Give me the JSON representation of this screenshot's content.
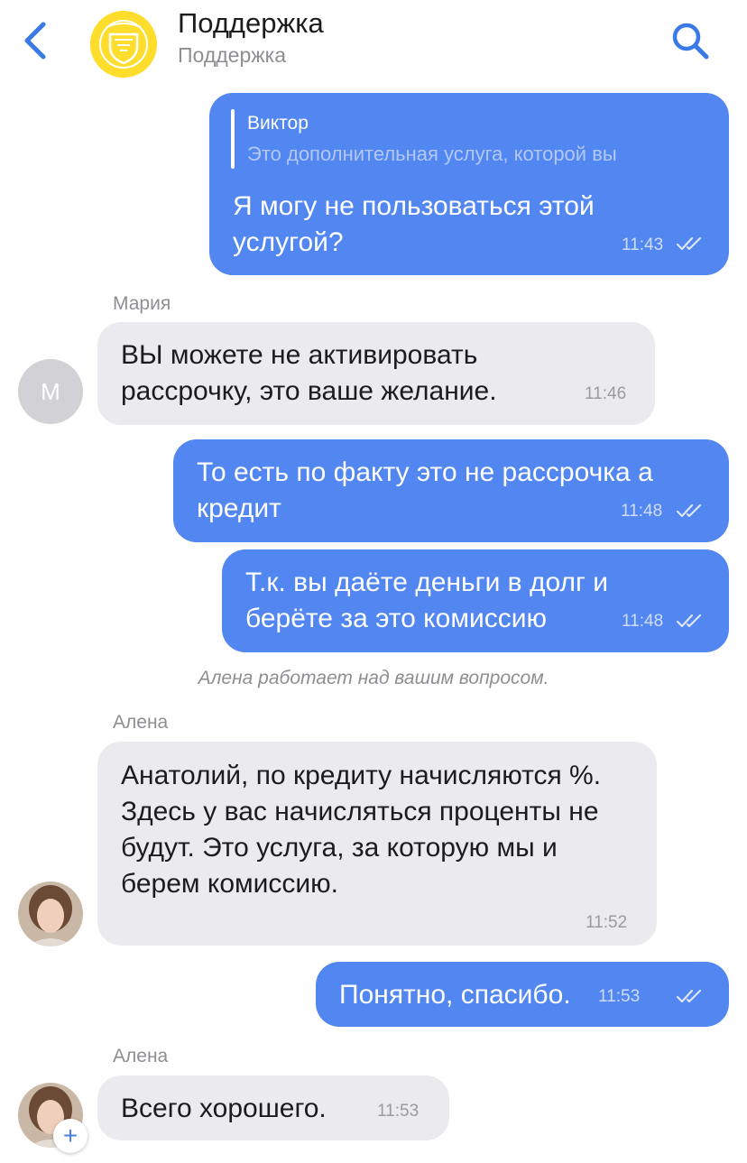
{
  "header": {
    "title": "Поддержка",
    "subtitle": "Поддержка"
  },
  "messages": [
    {
      "quote_author": "Виктор",
      "quote_text": "Это дополнительная услуга, которой вы",
      "text": "Я могу не пользоваться этой услугой?",
      "time": "11:43"
    },
    {
      "sender": "Мария",
      "avatar_letter": "М",
      "text": "ВЫ можете не активировать рассрочку, это ваше желание.",
      "time": "11:46"
    },
    {
      "text": "То есть по факту это не рассрочка а кредит",
      "time": "11:48"
    },
    {
      "text": "Т.к. вы даёте деньги в долг и берёте за это комиссию",
      "time": "11:48"
    },
    {
      "sender": "Алена",
      "text": "Анатолий, по кредиту начисляются %. Здесь у вас начисляться проценты не будут. Это услуга, за которую мы и берем комиссию.",
      "time": "11:52"
    },
    {
      "text": "Понятно, спасибо.",
      "time": "11:53"
    },
    {
      "sender": "Алена",
      "text": "Всего хорошего.",
      "time": "11:53"
    }
  ],
  "system_notice": "Алена работает над вашим вопросом.",
  "colors": {
    "outgoing_bubble": "#5286f0",
    "incoming_bubble": "#ebebef",
    "accent": "#3a7ae8",
    "logo_yellow": "#ffdd2d"
  }
}
